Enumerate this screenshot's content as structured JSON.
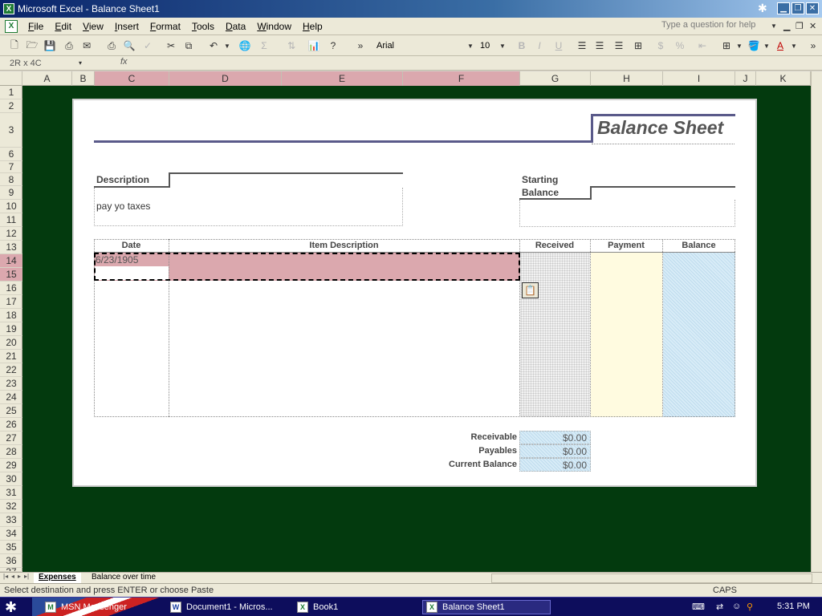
{
  "window": {
    "title": "Microsoft Excel - Balance Sheet1",
    "app_icon": "excel-icon"
  },
  "menu": {
    "items": [
      "File",
      "Edit",
      "View",
      "Insert",
      "Format",
      "Tools",
      "Data",
      "Window",
      "Help"
    ],
    "ask_placeholder": "Type a question for help"
  },
  "toolbar": {
    "font": "Arial",
    "size": "10"
  },
  "formula_bar": {
    "name_box": "2R x 4C",
    "fx": "fx"
  },
  "columns": [
    "A",
    "B",
    "C",
    "D",
    "E",
    "F",
    "G",
    "H",
    "I",
    "J",
    "K"
  ],
  "rows": [
    "1",
    "2",
    "3",
    "6",
    "7",
    "8",
    "9",
    "10",
    "11",
    "12",
    "13",
    "14",
    "15",
    "16",
    "17",
    "18",
    "19",
    "20",
    "21",
    "22",
    "23",
    "24",
    "25",
    "26",
    "27",
    "28",
    "29",
    "30",
    "31",
    "32",
    "33",
    "34",
    "35",
    "36",
    "37"
  ],
  "sheet": {
    "title": "Balance Sheet",
    "description_label": "Description",
    "description_value": "pay yo taxes",
    "starting_label_1": "Starting",
    "starting_label_2": "Balance",
    "table_headers": [
      "Date",
      "Item Description",
      "Received",
      "Payment",
      "Balance"
    ],
    "date_value": "6/23/1905",
    "totals": [
      {
        "label": "Receivable",
        "value": "$0.00"
      },
      {
        "label": "Payables",
        "value": "$0.00"
      },
      {
        "label": "Current Balance",
        "value": "$0.00"
      }
    ]
  },
  "tabs": [
    "Expenses",
    "Balance over time"
  ],
  "status": {
    "text": "Select destination and press ENTER or choose Paste",
    "caps": "CAPS"
  },
  "taskbar": {
    "tasks": [
      "MSN Messenger",
      "Document1 - Micros...",
      "Book1",
      "Balance Sheet1"
    ],
    "clock": "5:31 PM"
  },
  "colors": {
    "selection": "#dba8ae",
    "grid_bg": "#033a0e",
    "title_accent": "#5a5a8a"
  }
}
